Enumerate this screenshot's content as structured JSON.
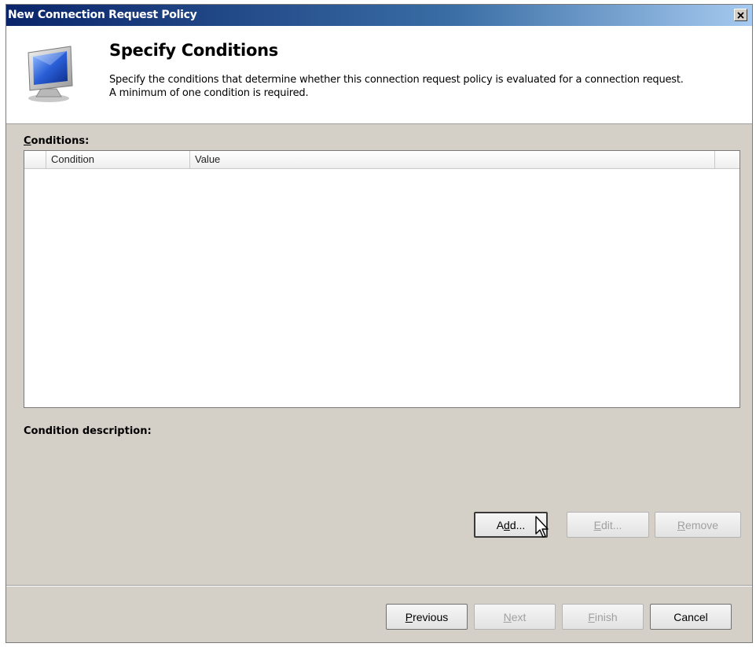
{
  "window": {
    "title": "New Connection Request Policy",
    "close_glyph": "✕"
  },
  "header": {
    "icon": "monitor-icon",
    "title": "Specify Conditions",
    "description_line1": "Specify the conditions that determine whether this connection request policy is evaluated for a connection request.",
    "description_line2": "A minimum of one condition is required."
  },
  "conditions": {
    "label_accel": "C",
    "label_rest": "onditions:",
    "columns": [
      "Condition",
      "Value"
    ],
    "rows": []
  },
  "condition_description": {
    "label": "Condition description:",
    "text": ""
  },
  "condition_buttons": {
    "add": {
      "accel": "d",
      "pre": "A",
      "post": "d...",
      "label": "Add..."
    },
    "edit": {
      "pre": "",
      "accel": "E",
      "post": "dit...",
      "label": "Edit..."
    },
    "remove": {
      "pre": "",
      "accel": "R",
      "post": "emove",
      "label": "Remove"
    }
  },
  "nav_buttons": {
    "previous": {
      "pre": "",
      "accel": "P",
      "post": "revious"
    },
    "next": {
      "pre": "",
      "accel": "N",
      "post": "ext"
    },
    "finish": {
      "pre": "",
      "accel": "F",
      "post": "inish"
    },
    "cancel": {
      "label": "Cancel"
    }
  },
  "colors": {
    "titlebar": "#0a246a",
    "dialog_bg": "#d4d0c8",
    "disabled_text": "#a0a0a0"
  }
}
